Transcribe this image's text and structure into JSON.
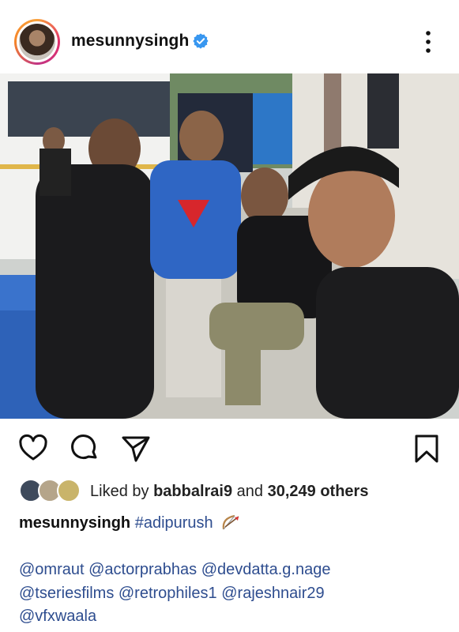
{
  "post": {
    "username": "mesunnysingh",
    "verified": true,
    "menu_icon": "more-vertical-icon",
    "photo_description_icon": "post-photo"
  },
  "actions": {
    "like_icon": "heart-icon",
    "comment_icon": "comment-icon",
    "share_icon": "send-icon",
    "save_icon": "bookmark-icon"
  },
  "likes": {
    "prefix": "Liked by",
    "user": "babbalrai9",
    "middle": "and",
    "count": "30,249 others"
  },
  "caption": {
    "username": "mesunnysingh",
    "hashtag": "#adipurush"
  },
  "mentions": [
    "@omraut @actorprabhas @devdatta.g.nage",
    "@tseriesfilms @retrophiles1 @rajeshnair29",
    "@vfxwaala"
  ],
  "colors": {
    "link": "#2e4d8f",
    "verified": "#3897f0",
    "text": "#111111"
  }
}
